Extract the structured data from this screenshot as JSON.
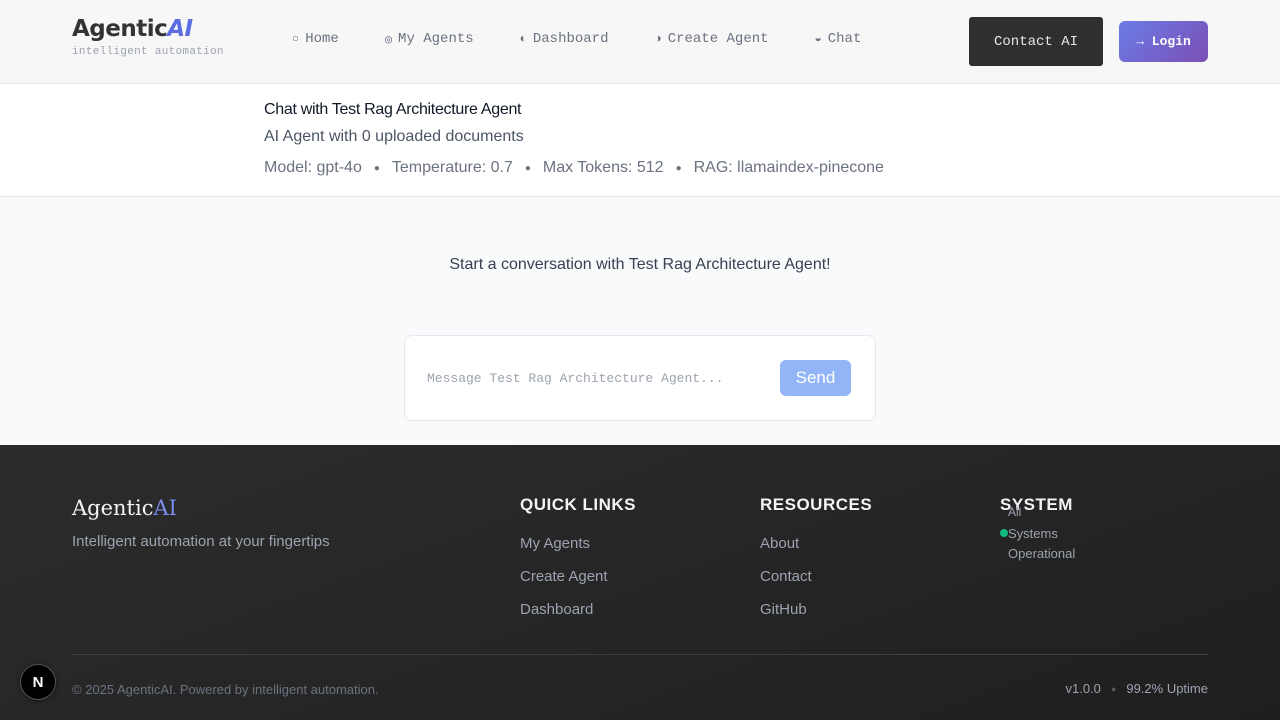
{
  "header": {
    "logo_main": "Agentic",
    "logo_accent": "AI",
    "tagline": "intelligent automation",
    "nav": [
      {
        "icon": "○",
        "label": "Home"
      },
      {
        "icon": "◎",
        "label": "My Agents"
      },
      {
        "icon": "◐",
        "label": "Dashboard"
      },
      {
        "icon": "◑",
        "label": "Create Agent"
      },
      {
        "icon": "◒",
        "label": "Chat"
      }
    ],
    "contact_label": "Contact AI",
    "login_label": "→ Login"
  },
  "agent": {
    "title": "Chat with Test Rag Architecture Agent",
    "subtitle": "AI Agent with 0 uploaded documents",
    "meta": {
      "model": "Model: gpt-4o",
      "temperature": "Temperature: 0.7",
      "max_tokens": "Max Tokens: 512",
      "rag": "RAG: llamaindex-pinecone"
    },
    "separator": "●"
  },
  "chat": {
    "empty_message": "Start a conversation with Test Rag Architecture Agent!",
    "input_placeholder": "Message Test Rag Architecture Agent...",
    "input_value": "",
    "send_label": "Send"
  },
  "footer": {
    "logo_main": "Agentic",
    "logo_accent": "AI",
    "tagline": "Intelligent automation at your fingertips",
    "quick_links": {
      "heading": "QUICK LINKS",
      "items": [
        "My Agents",
        "Create Agent",
        "Dashboard"
      ]
    },
    "resources": {
      "heading": "RESOURCES",
      "items": [
        "About",
        "Contact",
        "GitHub"
      ]
    },
    "system": {
      "heading": "SYSTEM",
      "all_label": "All",
      "status": "Systems Operational",
      "status_color": "#10b981"
    },
    "copyright": "© 2025 AgenticAI. Powered by intelligent automation.",
    "version": "v1.0.0",
    "separator": "●",
    "uptime": "99.2% Uptime"
  },
  "badge": {
    "letter": "N"
  }
}
